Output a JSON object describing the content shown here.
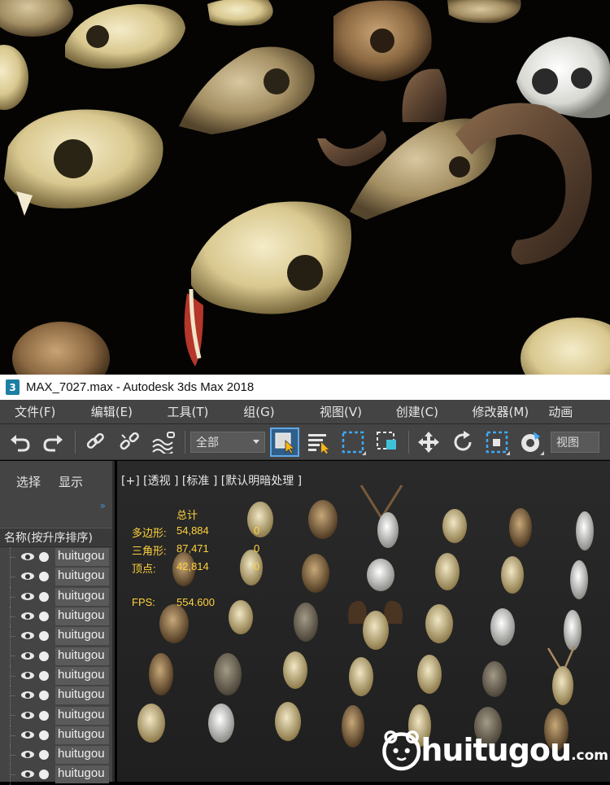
{
  "window": {
    "title": "MAX_7027.max - Autodesk 3ds Max 2018",
    "icon": "3ds-max-icon"
  },
  "menu": [
    {
      "label": "文件(F)"
    },
    {
      "label": "编辑(E)"
    },
    {
      "label": "工具(T)"
    },
    {
      "label": "组(G)"
    },
    {
      "label": "视图(V)"
    },
    {
      "label": "创建(C)"
    },
    {
      "label": "修改器(M)"
    },
    {
      "label": "动画"
    }
  ],
  "toolbar": {
    "selection_filter": "全部",
    "view_dropdown": "视图",
    "icons": [
      "undo-icon",
      "redo-icon",
      "link-icon",
      "unlink-icon",
      "bind-spacewarp-icon",
      "select-object-icon",
      "select-by-name-icon",
      "rect-selection-icon",
      "window-crossing-icon",
      "move-icon",
      "rotate-icon",
      "scale-icon",
      "snap-icon"
    ]
  },
  "explorer": {
    "tabs": [
      "选择",
      "显示"
    ],
    "column_header": "名称(按升序排序)",
    "rows": [
      {
        "name": "huitugou"
      },
      {
        "name": "huitugou"
      },
      {
        "name": "huitugou"
      },
      {
        "name": "huitugou"
      },
      {
        "name": "huitugou"
      },
      {
        "name": "huitugou"
      },
      {
        "name": "huitugou"
      },
      {
        "name": "huitugou"
      },
      {
        "name": "huitugou"
      },
      {
        "name": "huitugou"
      },
      {
        "name": "huitugou"
      },
      {
        "name": "huitugou"
      }
    ]
  },
  "viewport": {
    "label": "[+] [透视 ] [标准 ] [默认明暗处理 ]",
    "stats": {
      "header": "总计",
      "rows": [
        {
          "key": "多边形:",
          "value": "54,884",
          "sel": "0"
        },
        {
          "key": "三角形:",
          "value": "87,471",
          "sel": "0"
        },
        {
          "key": "顶点:",
          "value": "42,814",
          "sel": "0"
        }
      ],
      "fps_key": "FPS:",
      "fps_value": "554.600"
    },
    "stat_color": "#ffd23c"
  },
  "watermark": {
    "text": "huitugou",
    "tld": ".com"
  }
}
